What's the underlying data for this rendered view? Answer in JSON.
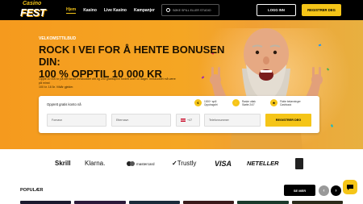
{
  "brand": {
    "line1": "Casino",
    "line2": "FEST"
  },
  "nav": {
    "items": [
      "Hjem",
      "Kasino",
      "Live Kasino",
      "Kampanjer"
    ],
    "search_placeholder": "SØKE SPILL ELLER STUDIO",
    "login_label": "LOGG INN",
    "register_label": "REGISTRER DEG"
  },
  "hero": {
    "eyebrow": "VELKOMSTTILBUD",
    "headline_1": "ROCK I VEI FOR Å HENTE BONUSEN DIN:",
    "headline_2": "100 % OPPTIL 10 000 KR",
    "small_1": "Opptil 10 000 kr på det første innskuddet ditt og 200 gratisspinn fordelt over 10 dager. Innskuddet må være på minst",
    "small_2": "100 kr. 18 år. Vilkår gjelder."
  },
  "form": {
    "title": "Opprett gratis konto nå",
    "features": [
      {
        "icon": "€",
        "text": "1000+ spill\nOppdragsfri"
      },
      {
        "icon": "⚡",
        "text": "Raske uttak\nStøtte 24/7"
      },
      {
        "icon": "★",
        "text": "Flotte belønninger\nCashback"
      }
    ],
    "first_name_placeholder": "Fornavn",
    "last_name_placeholder": "Etternavn",
    "country_code": "+47",
    "phone_placeholder": "Telefonnummer",
    "submit_label": "REGISTRER DEG"
  },
  "payments": [
    "Skrill",
    "Klarna.",
    "mastercard",
    "Trustly",
    "VISA",
    "NETELLER"
  ],
  "popular": {
    "title": "POPULÆR",
    "see_all_label": "SE MER",
    "prev_arrow": "‹",
    "next_arrow": "›"
  },
  "colors": {
    "accent": "#f5c518",
    "hero": "#f5a623",
    "nav": "#000000"
  }
}
